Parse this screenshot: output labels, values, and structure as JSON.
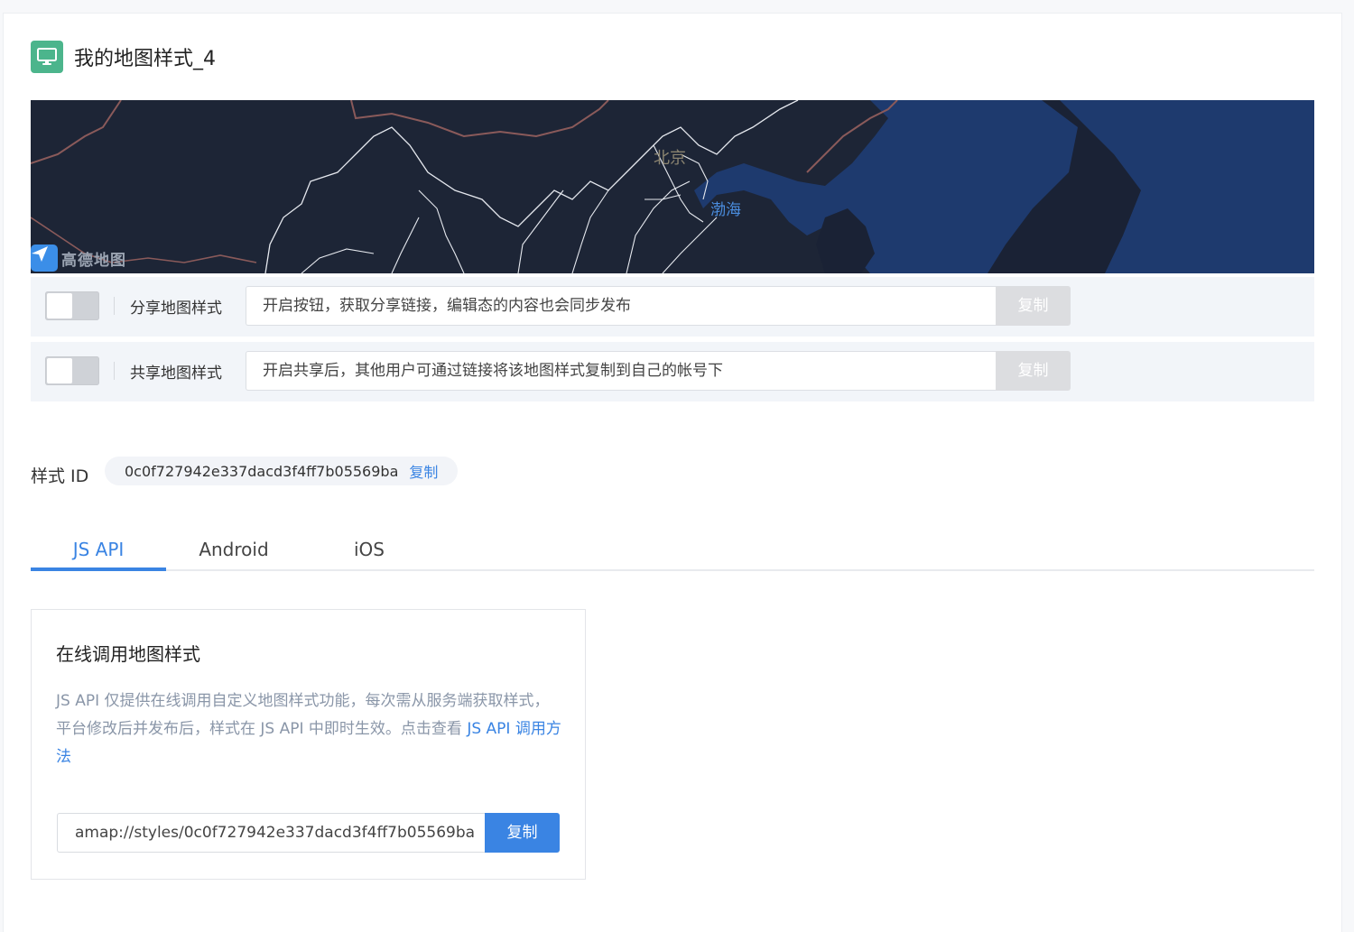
{
  "header": {
    "title": "我的地图样式_4",
    "icon": "monitor-icon",
    "icon_color": "#4cb58c"
  },
  "map": {
    "logo_text": "高德地图",
    "labels": {
      "beijing": "北京",
      "bohai": "渤海"
    }
  },
  "share_rows": [
    {
      "label": "分享地图样式",
      "input_text": "开启按钮，获取分享链接，编辑态的内容也会同步发布",
      "copy_label": "复制",
      "enabled": false
    },
    {
      "label": "共享地图样式",
      "input_text": "开启共享后，其他用户可通过链接将该地图样式复制到自己的帐号下",
      "copy_label": "复制",
      "enabled": false
    }
  ],
  "style_id": {
    "label": "样式 ID",
    "value": "0c0f727942e337dacd3f4ff7b05569ba",
    "copy_label": "复制"
  },
  "tabs": [
    {
      "label": "JS API",
      "active": true
    },
    {
      "label": "Android",
      "active": false
    },
    {
      "label": "iOS",
      "active": false
    }
  ],
  "panel": {
    "title": "在线调用地图样式",
    "description": "JS API 仅提供在线调用自定义地图样式功能，每次需从服务端获取样式，平台修改后并发布后，样式在 JS API 中即时生效。点击查看 ",
    "link_text": "JS API 调用方法",
    "url_value": "amap://styles/0c0f727942e337dacd3f4ff7b05569ba",
    "copy_label": "复制"
  },
  "colors": {
    "accent": "#3a84e3",
    "map_land": "#1d2536",
    "map_sea": "#1e3a6e",
    "disabled_button": "#dcdde0"
  }
}
